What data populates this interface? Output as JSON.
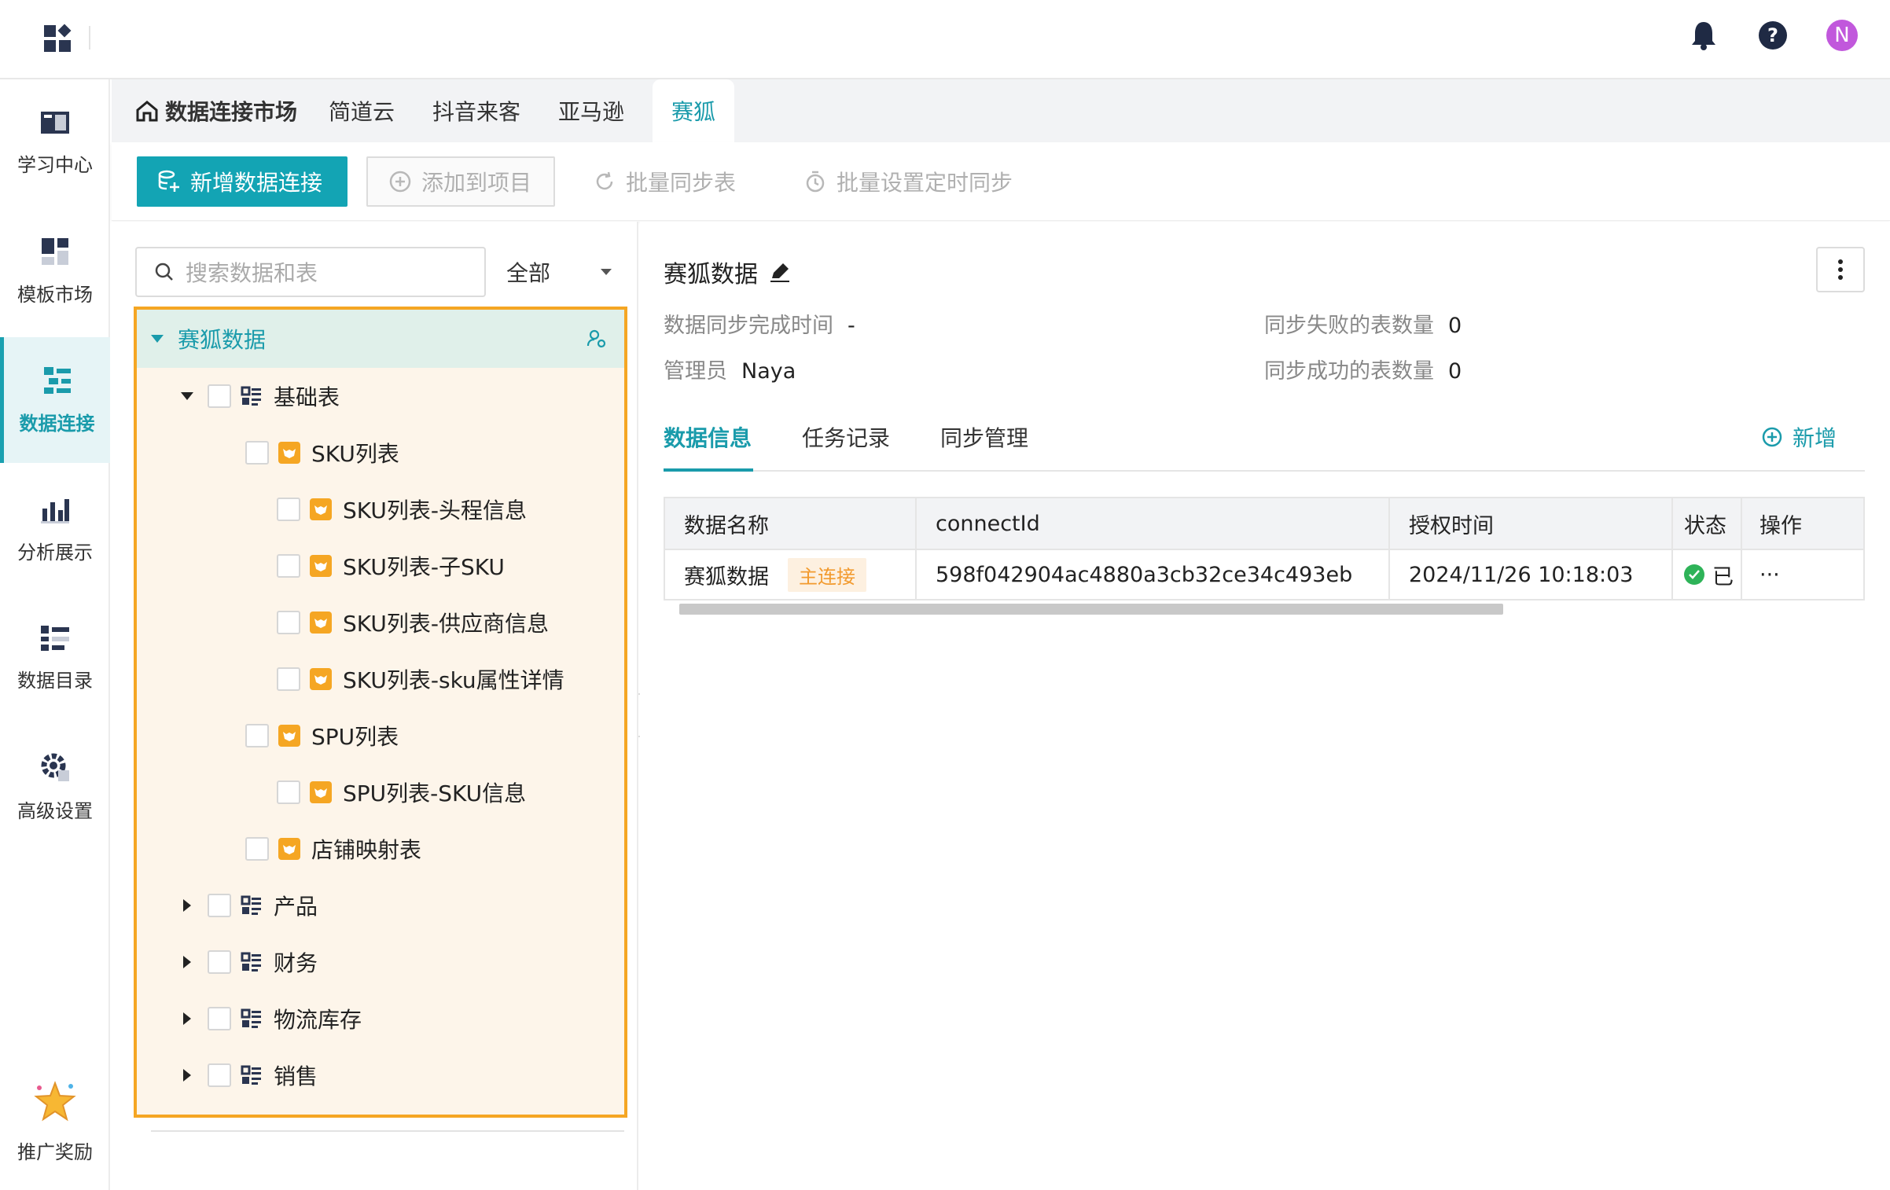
{
  "header": {
    "avatar_letter": "N",
    "icons": [
      "apps-icon",
      "bell-icon",
      "help-icon"
    ]
  },
  "sidebar": {
    "items": [
      {
        "label": "学习中心",
        "icon": "book-icon"
      },
      {
        "label": "模板市场",
        "icon": "template-icon"
      },
      {
        "label": "数据连接",
        "icon": "data-connect-icon",
        "active": true
      },
      {
        "label": "分析展示",
        "icon": "chart-icon"
      },
      {
        "label": "数据目录",
        "icon": "catalog-icon"
      },
      {
        "label": "高级设置",
        "icon": "gear-icon"
      },
      {
        "label": "推广奖励",
        "icon": "star-icon"
      }
    ]
  },
  "tabs": {
    "items": [
      "数据连接市场",
      "简道云",
      "抖音来客",
      "亚马逊",
      "赛狐"
    ]
  },
  "toolbar": {
    "new_connection": "新增数据连接",
    "add_to_project": "添加到项目",
    "batch_sync": "批量同步表",
    "batch_schedule": "批量设置定时同步"
  },
  "left": {
    "search_placeholder": "搜索数据和表",
    "filter": "全部",
    "tree": {
      "root": "赛狐数据",
      "groups": {
        "basic": "基础表",
        "products": "产品",
        "finance": "财务",
        "logistics": "物流库存",
        "sales": "销售"
      },
      "tables": [
        "SKU列表",
        "SKU列表-头程信息",
        "SKU列表-子SKU",
        "SKU列表-供应商信息",
        "SKU列表-sku属性详情",
        "SPU列表",
        "SPU列表-SKU信息",
        "店铺映射表"
      ]
    }
  },
  "detail": {
    "title": "赛狐数据",
    "sync_done_label": "数据同步完成时间",
    "sync_done_value": "-",
    "admin_label": "管理员",
    "admin_value": "Naya",
    "fail_label": "同步失败的表数量",
    "fail_value": "0",
    "success_label": "同步成功的表数量",
    "success_value": "0",
    "tabs": [
      "数据信息",
      "任务记录",
      "同步管理"
    ],
    "add_label": "新增",
    "table": {
      "headers": [
        "数据名称",
        "connectId",
        "授权时间",
        "状态",
        "操作"
      ],
      "row": {
        "name": "赛狐数据",
        "badge": "主连接",
        "connectId": "598f042904ac4880a3cb32ce34c493eb",
        "auth_time": "2024/11/26 10:18:03",
        "status": "已",
        "action": "···"
      }
    }
  },
  "colors": {
    "accent": "#13a4b4",
    "highlight_border": "#f5a623",
    "status_ok": "#2eb358"
  }
}
